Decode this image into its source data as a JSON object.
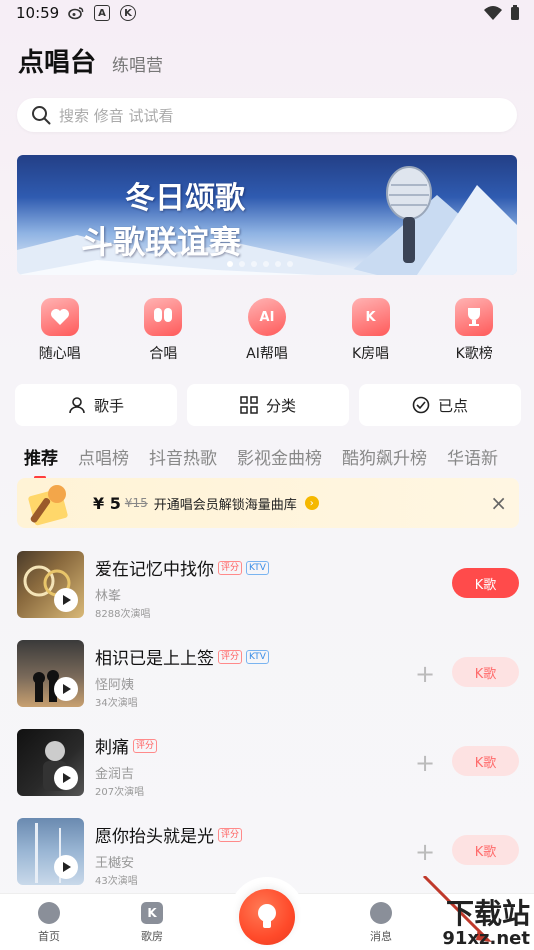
{
  "status": {
    "time": "10:59",
    "icons_left": [
      "weibo-icon",
      "A",
      "K"
    ]
  },
  "header": {
    "title": "点唱台",
    "subtitle": "练唱营"
  },
  "search": {
    "placeholder": "搜索 修音 试试看"
  },
  "banner": {
    "line1": "冬日颂歌",
    "line2": "斗歌联谊赛",
    "dot_count": 6,
    "active_dot": 0
  },
  "quick_actions": [
    {
      "label": "随心唱",
      "icon": "heart-icon"
    },
    {
      "label": "合唱",
      "icon": "mic-pair-icon"
    },
    {
      "label": "AI帮唱",
      "icon": "ai-icon"
    },
    {
      "label": "K房唱",
      "icon": "k-room-icon"
    },
    {
      "label": "K歌榜",
      "icon": "trophy-icon"
    }
  ],
  "chips": [
    {
      "label": "歌手",
      "icon": "person-icon"
    },
    {
      "label": "分类",
      "icon": "grid-icon"
    },
    {
      "label": "已点",
      "icon": "check-circle-icon"
    }
  ],
  "tabs": [
    "推荐",
    "点唱榜",
    "抖音热歌",
    "影视金曲榜",
    "酷狗飙升榜",
    "华语新"
  ],
  "promo": {
    "currency": "¥",
    "price": "5",
    "old_price": "¥15",
    "text": "开通唱会员解锁海量曲库"
  },
  "songs": [
    {
      "title": "爱在记忆中找你",
      "tags": [
        "评分",
        "KTV"
      ],
      "singer": "林峯",
      "plays": "8288次演唱",
      "button": "K歌",
      "style": "primary"
    },
    {
      "title": "相识已是上上签",
      "tags": [
        "评分",
        "KTV"
      ],
      "singer": "怪阿姨",
      "plays": "34次演唱",
      "button": "K歌",
      "style": "soft"
    },
    {
      "title": "刺痛",
      "tags": [
        "评分"
      ],
      "singer": "金润吉",
      "plays": "207次演唱",
      "button": "K歌",
      "style": "soft"
    },
    {
      "title": "愿你抬头就是光",
      "tags": [
        "评分"
      ],
      "singer": "王樾安",
      "plays": "43次演唱",
      "button": "K歌",
      "style": "soft"
    }
  ],
  "bottom_nav": [
    {
      "label": "首页"
    },
    {
      "label": "歌房"
    },
    {
      "label": "消息"
    }
  ],
  "watermark": {
    "line1": "下载站",
    "line2": "91xz.net"
  },
  "colors": {
    "accent": "#ff4b4b",
    "promo_bg": "#fff3d6",
    "banner_top": "#233f86"
  }
}
